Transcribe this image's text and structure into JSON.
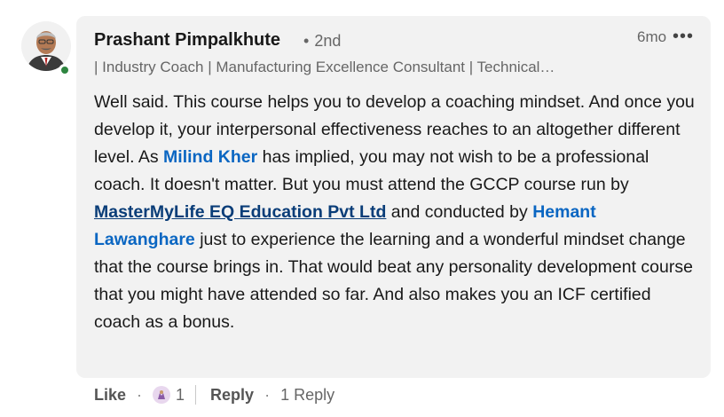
{
  "comment": {
    "author": "Prashant Pimpalkhute",
    "degree": "2nd",
    "headline": "| Industry Coach | Manufacturing Excellence Consultant | Technical…",
    "time": "6mo",
    "more_label": "•••",
    "presence_color": "#2e8540",
    "text": {
      "p1": "Well said. This course helps you to develop a coaching mindset. And once you develop it, your interpersonal effectiveness reaches to an altogether different level. As ",
      "mention1": "Milind Kher",
      "p2": " has implied, you may not wish to be a professional coach. It doesn't matter. But you must attend the GCCP course run by ",
      "company": "MasterMyLife EQ Education Pvt Ltd",
      "p3": " and conducted by ",
      "mention2": "Hemant Lawanghare",
      "p4": " just to experience the learning and a wonderful mindset change that the course brings in. That would beat any personality development course that you might have attended so far. And also makes you an ICF certified coach as a bonus."
    }
  },
  "actions": {
    "like": "Like",
    "reaction_icon": "praise-hands-icon",
    "reaction_count": "1",
    "reply": "Reply",
    "replies": "1 Reply"
  },
  "colors": {
    "link": "#0a66c2",
    "company_link": "#0a3d78",
    "bubble": "#f2f2f2"
  }
}
